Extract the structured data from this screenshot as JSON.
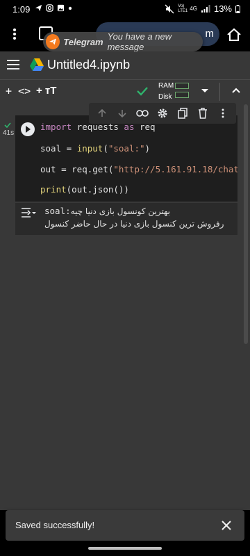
{
  "status_bar": {
    "time": "1:09",
    "network_label": "4G",
    "lte_label": "Vo) LTE1",
    "battery": "13%"
  },
  "browser": {
    "url_tail": "m"
  },
  "telegram_toast": {
    "app": "Telegram",
    "message": "You have a new message",
    "accent": "#f47a1e"
  },
  "colab": {
    "title": "Untitled4.ipynb",
    "toolbar": {
      "add_code": "+ <>",
      "add_text": "+ тT",
      "ram_label": "RAM",
      "disk_label": "Disk"
    },
    "cell": {
      "exec_time": "41s",
      "code_lines": [
        {
          "kw1": "import",
          "t1": " requests ",
          "kw2": "as",
          "t2": " req"
        },
        {
          "t1": "soal = ",
          "fn": "input",
          "t2": "(",
          "str": "\"soal:\"",
          "t3": ")"
        },
        {
          "t1": "out = req.get(",
          "str": "\"http://5.161.91.18/chat"
        },
        {
          "fn": "print",
          "t1": "(out.json())"
        }
      ],
      "output": {
        "line1_prefix": "soal:",
        "line1_rtl": "بهترین کونسول بازی دنیا چیه",
        "line2_rtl": "رفروش ترین کنسول بازی دنیا در حال حاضر کنسول"
      }
    },
    "snackbar": {
      "text": "Saved successfully!"
    }
  },
  "colors": {
    "check_green": "#2fb36c",
    "keyword": "#c586c0",
    "function": "#e0d17a",
    "string": "#ce9178"
  }
}
